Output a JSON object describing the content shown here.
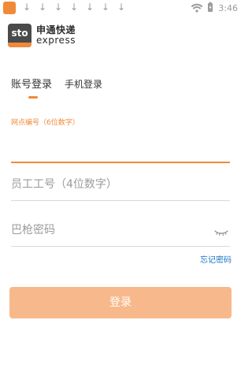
{
  "status_bar": {
    "time": "3:46",
    "app_icon": "sto-app-icon",
    "download_icons": [
      "download-arrow-icon",
      "download-arrow-icon",
      "download-arrow-icon",
      "download-arrow-icon",
      "download-arrow-icon",
      "download-arrow-icon",
      "download-arrow-icon"
    ],
    "status_icons": [
      "wifi-icon",
      "battery-charging-icon"
    ]
  },
  "logo": {
    "mark_text": "sto",
    "cn": "申通快递",
    "en": "express"
  },
  "tabs": [
    {
      "label": "账号登录",
      "active": true
    },
    {
      "label": "手机登录",
      "active": false
    }
  ],
  "fields": {
    "network_id": {
      "label": "网点编号（6位数字）",
      "value": ""
    },
    "employee_id": {
      "placeholder": "员工工号（4位数字）"
    },
    "password": {
      "placeholder": "巴枪密码",
      "icon": "eye-closed-icon"
    }
  },
  "forgot_password": "忘记密码",
  "login_button": "登录",
  "colors": {
    "accent": "#f08a3a",
    "button": "#f7b98b",
    "link": "#1a73c4"
  }
}
